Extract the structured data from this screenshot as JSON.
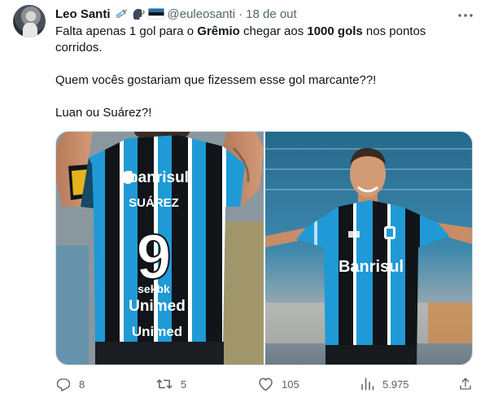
{
  "tweet": {
    "author_name": "Leo Santi",
    "handle": "@euleosanti",
    "separator": "·",
    "date": "18 de out",
    "text": {
      "line1_a": "Falta apenas 1 gol para o ",
      "line1_b": "Grêmio",
      "line1_c": " chegar aos ",
      "line1_d": "1000 gols",
      "line1_e": " nos pontos corridos.",
      "line2": "Quem vocês gostariam que fizessem esse gol marcante??!",
      "line3": "Luan ou Suárez?!"
    },
    "photos": {
      "left": {
        "jersey_sponsor": "banrisul",
        "jersey_name": "SUÁREZ",
        "jersey_number": "9",
        "jersey_text_1": "Unimed",
        "jersey_text_2": "Unimed",
        "jersey_text_3": "sekbk"
      },
      "right": {
        "jersey_sponsor": "Banrisul"
      }
    },
    "actions": {
      "replies": "8",
      "reposts": "5",
      "likes": "105",
      "views": "5.975"
    }
  },
  "colors": {
    "text_primary": "#0f1419",
    "text_secondary": "#536471",
    "gremio_blue": "#1f9ad6",
    "gremio_black": "#111418"
  },
  "icons": [
    "more-icon",
    "reply-icon",
    "repost-icon",
    "like-icon",
    "views-icon",
    "share-icon",
    "syringe-emoji",
    "speaking-head-emoji",
    "estonia-flag-emoji"
  ]
}
